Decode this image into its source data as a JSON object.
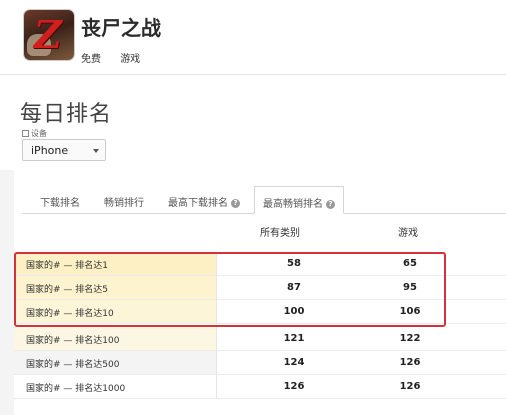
{
  "app": {
    "name": "丧尸之战",
    "price": "免费",
    "category": "游戏",
    "icon": "zombie-game-icon"
  },
  "section": {
    "title": "每日排名",
    "device_label": "设备",
    "device_value": "iPhone"
  },
  "tabs": [
    {
      "label": "下载排名",
      "info": false
    },
    {
      "label": "畅销排行",
      "info": false
    },
    {
      "label": "最高下载排名",
      "info": true
    },
    {
      "label": "最高畅销排名",
      "info": true,
      "active": true
    }
  ],
  "table": {
    "headers": [
      "所有类别",
      "游戏"
    ],
    "rows": [
      {
        "label": "国家的# — 排名达1",
        "all": "58",
        "games": "65"
      },
      {
        "label": "国家的# — 排名达5",
        "all": "87",
        "games": "95"
      },
      {
        "label": "国家的# — 排名达10",
        "all": "100",
        "games": "106"
      },
      {
        "label": "国家的# — 排名达100",
        "all": "121",
        "games": "122"
      },
      {
        "label": "国家的# — 排名达500",
        "all": "124",
        "games": "126"
      },
      {
        "label": "国家的# — 排名达1000",
        "all": "126",
        "games": "126"
      }
    ]
  },
  "colors": {
    "highlight_border": "#d2323b",
    "row_bg_top": "#fdf1c7",
    "row_bg_other": "#f5f5f5"
  }
}
